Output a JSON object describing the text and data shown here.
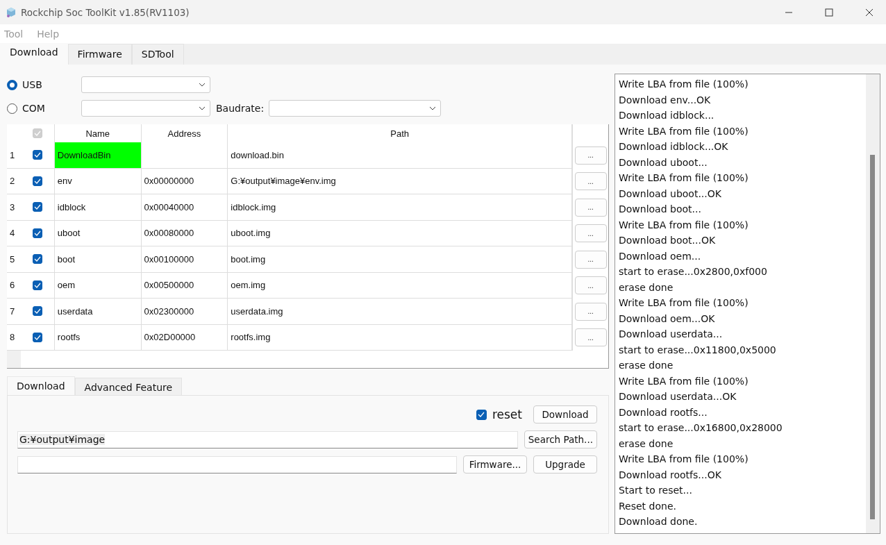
{
  "window": {
    "title": "Rockchip Soc ToolKit v1.85(RV1103)"
  },
  "menu": [
    "Tool",
    "Help"
  ],
  "tabs": [
    {
      "label": "Download",
      "selected": true
    },
    {
      "label": "Firmware",
      "selected": false
    },
    {
      "label": "SDTool",
      "selected": false
    }
  ],
  "connection": [
    {
      "label": "USB",
      "selected": true
    },
    {
      "label": "COM",
      "selected": false
    }
  ],
  "baudrate_label": "Baudrate:",
  "table": {
    "columns": [
      "Name",
      "Address",
      "Path"
    ],
    "header_checkbox": {
      "checked": true,
      "disabled": true
    },
    "browse_label": "...",
    "rows": [
      {
        "index": "1",
        "checked": true,
        "name": "DownloadBin",
        "highlighted": true,
        "address": "",
        "path": "download.bin"
      },
      {
        "index": "2",
        "checked": true,
        "name": "env",
        "highlighted": false,
        "address": "0x00000000",
        "path": "G:¥output¥image¥env.img"
      },
      {
        "index": "3",
        "checked": true,
        "name": "idblock",
        "highlighted": false,
        "address": "0x00040000",
        "path": "idblock.img"
      },
      {
        "index": "4",
        "checked": true,
        "name": "uboot",
        "highlighted": false,
        "address": "0x00080000",
        "path": "uboot.img"
      },
      {
        "index": "5",
        "checked": true,
        "name": "boot",
        "highlighted": false,
        "address": "0x00100000",
        "path": "boot.img"
      },
      {
        "index": "6",
        "checked": true,
        "name": "oem",
        "highlighted": false,
        "address": "0x00500000",
        "path": "oem.img"
      },
      {
        "index": "7",
        "checked": true,
        "name": "userdata",
        "highlighted": false,
        "address": "0x02300000",
        "path": "userdata.img"
      },
      {
        "index": "8",
        "checked": true,
        "name": "rootfs",
        "highlighted": false,
        "address": "0x02D00000",
        "path": "rootfs.img"
      }
    ]
  },
  "sub_tabs": [
    {
      "label": "Download",
      "selected": true
    },
    {
      "label": "Advanced Feature",
      "selected": false
    }
  ],
  "reset": {
    "label": "reset",
    "checked": true
  },
  "download_button": "Download",
  "path_field": {
    "value": "G:¥output¥image"
  },
  "search_path_button": "Search Path...",
  "firmware_button": "Firmware...",
  "upgrade_button": "Upgrade",
  "log": [
    "Write LBA from file (100%)",
    "Download env...OK",
    "Download idblock...",
    "Write LBA from file (100%)",
    "Download idblock...OK",
    "Download uboot...",
    "Write LBA from file (100%)",
    "Download uboot...OK",
    "Download boot...",
    "Write LBA from file (100%)",
    "Download boot...OK",
    "Download oem...",
    "start to erase...0x2800,0xf000",
    "erase done",
    "Write LBA from file (100%)",
    "Download oem...OK",
    "Download userdata...",
    "start to erase...0x11800,0x5000",
    "erase done",
    "Write LBA from file (100%)",
    "Download userdata...OK",
    "Download rootfs...",
    "start to erase...0x16800,0x28000",
    "erase done",
    "Write LBA from file (100%)",
    "Download rootfs...OK",
    "Start to reset...",
    "Reset done.",
    "Download done."
  ]
}
